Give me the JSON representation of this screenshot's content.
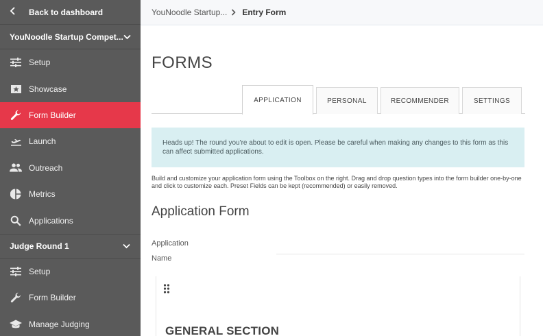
{
  "sidebar": {
    "back_label": "Back to dashboard",
    "competition_title": "YouNoodle Startup Compet...",
    "competition_items": [
      {
        "label": "Setup",
        "icon": "sliders-icon"
      },
      {
        "label": "Showcase",
        "icon": "star-showcase-icon"
      },
      {
        "label": "Form Builder",
        "icon": "wrench-icon"
      },
      {
        "label": "Launch",
        "icon": "plane-icon"
      },
      {
        "label": "Outreach",
        "icon": "people-icon"
      },
      {
        "label": "Metrics",
        "icon": "pie-chart-icon"
      },
      {
        "label": "Applications",
        "icon": "search-icon"
      }
    ],
    "round_title": "Judge Round 1",
    "round_items": [
      {
        "label": "Setup",
        "icon": "sliders-icon"
      },
      {
        "label": "Form Builder",
        "icon": "wrench-icon"
      },
      {
        "label": "Manage Judging",
        "icon": "graduation-cap-icon"
      }
    ],
    "active_color": "#e6384a"
  },
  "breadcrumb": {
    "parent": "YouNoodle Startup...",
    "current": "Entry Form"
  },
  "main": {
    "page_title": "FORMS",
    "tabs": [
      "APPLICATION",
      "PERSONAL",
      "RECOMMENDER",
      "SETTINGS"
    ],
    "active_tab": "APPLICATION",
    "alert": "Heads up! The round you're about to edit is open. Please be careful when making any changes to this form as this can affect submitted applications.",
    "description": "Build and customize your application form using the Toolbox on the right. Drag and drop question types into the form builder one-by-one and click to customize each. Preset Fields can be kept (recommended) or easily removed.",
    "form_title": "Application Form",
    "field_label_line1": "Application",
    "field_label_line2": "Name",
    "section_name": "GENERAL SECTION"
  }
}
